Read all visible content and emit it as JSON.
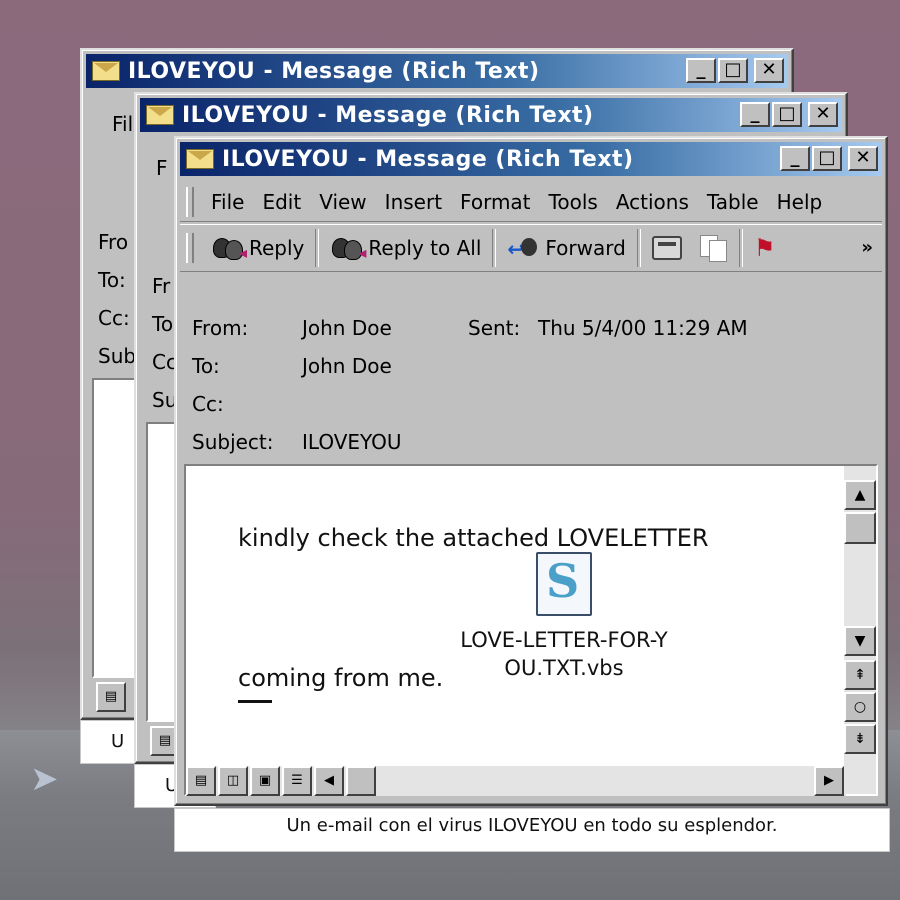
{
  "window": {
    "title": "ILOVEYOU - Message (Rich Text)",
    "buttons": {
      "minimize": "_",
      "maximize": "□",
      "close": "✕"
    }
  },
  "menu": {
    "file": "File",
    "edit": "Edit",
    "view": "View",
    "insert": "Insert",
    "format": "Format",
    "tools": "Tools",
    "actions": "Actions",
    "table": "Table",
    "help": "Help"
  },
  "toolbar": {
    "reply": "Reply",
    "reply_all": "Reply to All",
    "forward": "Forward",
    "more": "»"
  },
  "header": {
    "from_label": "From:",
    "from_value": "John Doe",
    "sent_label": "Sent:",
    "sent_value": "Thu 5/4/00 11:29 AM",
    "to_label": "To:",
    "to_value": "John Doe",
    "cc_label": "Cc:",
    "subject_label": "Subject:",
    "subject_value": "ILOVEYOU"
  },
  "body": {
    "line1": "kindly check the attached LOVELETTER",
    "line2": "coming from me.",
    "attachment_line1": "LOVE-LETTER-FOR-Y",
    "attachment_line2": "OU.TXT.vbs"
  },
  "back_windows": {
    "menu_partial_1": "Fil",
    "menu_partial_2": "F",
    "from_partial_1": "Fro",
    "to_partial_1": "To:",
    "cc_partial_1": "Cc:",
    "sub_partial_1": "Sub",
    "from_partial_2": "Fr",
    "to_partial_2": "To",
    "cc_partial_2": "Cc",
    "sub_partial_2": "Su",
    "caption_partial_1": "U",
    "caption_partial_2": "U"
  },
  "caption": "Un e-mail con el virus ILOVEYOU en todo su esplendor.",
  "colors": {
    "titlebar_start": "#0a246a",
    "titlebar_end": "#a6caf0",
    "window_face": "#c0c0c0",
    "background": "#8b6a7c"
  }
}
